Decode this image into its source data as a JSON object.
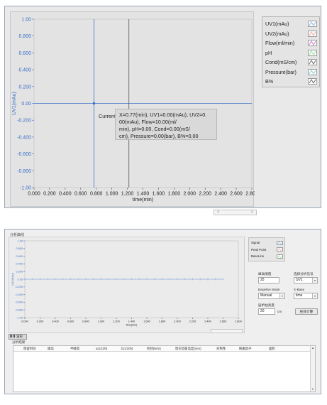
{
  "panel1": {
    "y_axis_label": "UV1(mAu)",
    "x_axis_label": "time(min)",
    "y_ticks": [
      "1.00",
      "0.800",
      "0.600",
      "0.400",
      "0.200",
      "0.00",
      "-0.200",
      "-0.400",
      "-0.600",
      "-0.800",
      "-1.00"
    ],
    "x_ticks": [
      "0.000",
      "0.200",
      "0.400",
      "0.600",
      "0.800",
      "1.000",
      "1.200",
      "1.400",
      "1.600",
      "1.800",
      "2.000",
      "2.200",
      "2.400",
      "2.600",
      "2.800"
    ],
    "legend": [
      "UV1(mAu)",
      "UV2(mAu)",
      "Flow(ml/min)",
      "pH",
      "Cond(mS/cm)",
      "Pressure(bar)",
      "B%"
    ],
    "legend_colors": [
      "#7fb3e6",
      "#f0a0a0",
      "#d070d0",
      "#90e090",
      "#606060",
      "#80d0d0",
      "#606060"
    ],
    "cursor_label": "Current",
    "cursor_readout_lines": [
      "X=0.77(min), UV1=0.00(mAu), UV2=0.",
      "00(mAu), Flow=10.00(ml/",
      "min), pH=0.00, Cond=0.00(mS/",
      "cm), Pressure=0.00(bar), B%=0.00"
    ],
    "cursor_x": 0.77,
    "cursor_y": 0.0,
    "second_cursor_x": 1.22,
    "plot_bg": "#e3e3e3",
    "axis_color": "#3a6fc9",
    "scroll_left": "<",
    "scroll_right": ">"
  },
  "panel2": {
    "title": "分析曲线",
    "y_axis_label": "UV1(mAu)",
    "x_axis_label": "time(min)",
    "y_ticks": [
      "1.00",
      "0.800",
      "0.600",
      "0.400",
      "0.200",
      "0.00",
      "-0.200",
      "-0.400",
      "-0.600",
      "-0.800",
      "-1.00"
    ],
    "x_ticks": [
      "0.000",
      "0.200",
      "0.400",
      "0.600",
      "0.800",
      "1.000",
      "1.200",
      "1.400",
      "1.600",
      "1.800",
      "2.000",
      "2.200",
      "2.400",
      "2.600",
      "2.800"
    ],
    "legend": [
      "Signal",
      "Peak Point",
      "BaseLine"
    ],
    "legend_colors": [
      "#7fb3e6",
      "#f0a0a0",
      "#90e090"
    ],
    "peak_height_label": "峰高阈值",
    "peak_height_value": "25",
    "select_analysis_label": "选择分析信号",
    "select_analysis_value": "UV1",
    "baseline_mode_label": "Baseline Mode",
    "baseline_mode_value": "Manual",
    "x_base_label": "X-Base",
    "x_base_value": "time",
    "column_height_label": "层析柱高度",
    "column_height_value": "20",
    "column_height_unit": "cm",
    "calculate_button": "柱效计算",
    "tab_label": "波形",
    "result_label": "分析结果",
    "table_headers": [
      "保留时间",
      "峰高",
      "半峰宽",
      "a(1/10h)",
      "b(1/10h)",
      "柱效(N/m)",
      "理论塔板高度(mm)",
      "对称性",
      "拖尾因子",
      "面积"
    ],
    "signal_points_x": [
      0.0,
      0.1,
      0.2,
      0.3,
      0.4,
      0.5,
      0.6,
      0.7,
      0.8,
      0.9,
      1.0,
      1.1,
      1.2,
      1.3,
      1.4,
      1.5,
      1.6,
      1.7,
      1.8,
      1.9,
      2.0,
      2.1,
      2.2,
      2.3,
      2.4,
      2.5,
      2.6
    ],
    "signal_value": 0.0
  },
  "chart_data": [
    {
      "type": "line",
      "title": "",
      "xlabel": "time(min)",
      "ylabel": "UV1(mAu)",
      "xlim": [
        0.0,
        2.8
      ],
      "ylim": [
        -1.0,
        1.0
      ],
      "series": [],
      "legend": [
        "UV1(mAu)",
        "UV2(mAu)",
        "Flow(ml/min)",
        "pH",
        "Cond(mS/cm)",
        "Pressure(bar)",
        "B%"
      ],
      "legend_position": "right",
      "grid": false
    },
    {
      "type": "line",
      "title": "",
      "xlabel": "time(min)",
      "ylabel": "UV1(mAu)",
      "xlim": [
        0.0,
        2.8
      ],
      "ylim": [
        -1.0,
        1.0
      ],
      "series": [
        {
          "name": "Signal",
          "x": [
            0.0,
            0.1,
            0.2,
            0.3,
            0.4,
            0.5,
            0.6,
            0.7,
            0.8,
            0.9,
            1.0,
            1.1,
            1.2,
            1.3,
            1.4,
            1.5,
            1.6,
            1.7,
            1.8,
            1.9,
            2.0,
            2.1,
            2.2,
            2.3,
            2.4,
            2.5,
            2.6
          ],
          "values": [
            0,
            0,
            0,
            0,
            0,
            0,
            0,
            0,
            0,
            0,
            0,
            0,
            0,
            0,
            0,
            0,
            0,
            0,
            0,
            0,
            0,
            0,
            0,
            0,
            0,
            0,
            0
          ]
        }
      ],
      "legend": [
        "Signal",
        "Peak Point",
        "BaseLine"
      ],
      "legend_position": "right",
      "grid": false
    }
  ]
}
